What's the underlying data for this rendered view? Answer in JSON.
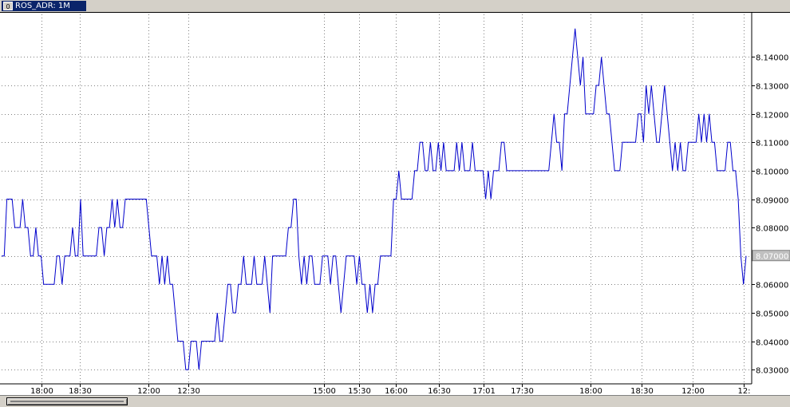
{
  "window": {
    "tab_label": "ROS_ADR: 1M",
    "tab_icon": "0"
  },
  "colors": {
    "line": "#0000cc",
    "axis": "#000000",
    "grid": "#808080",
    "price_box": "#c0c0c0"
  },
  "chart_data": {
    "type": "line",
    "title": "",
    "xlabel": "",
    "ylabel": "",
    "ylim": [
      8.025,
      8.155
    ],
    "y_ticks": [
      "8.03000",
      "8.04000",
      "8.05000",
      "8.06000",
      "8.07000",
      "8.08000",
      "8.09000",
      "8.10000",
      "8.11000",
      "8.12000",
      "8.13000",
      "8.14000"
    ],
    "y_tick_values": [
      8.03,
      8.04,
      8.05,
      8.06,
      8.07,
      8.08,
      8.09,
      8.1,
      8.11,
      8.12,
      8.13,
      8.14
    ],
    "x_tick_labels": [
      "18:00",
      "18:30",
      "12:00",
      "12:30",
      "15:00",
      "15:30",
      "16:00",
      "16:30",
      "17:01",
      "17:30",
      "18:00",
      "18:30",
      "12:00",
      "12:"
    ],
    "x_tick_index": [
      52,
      100,
      186,
      236,
      406,
      450,
      496,
      550,
      606,
      654,
      740,
      804,
      868,
      932
    ],
    "current_price": "8.07000",
    "grid": "dotted",
    "series": [
      {
        "values": [
          8.07,
          8.07,
          8.09,
          8.09,
          8.09,
          8.08,
          8.08,
          8.08,
          8.09,
          8.08,
          8.08,
          8.07,
          8.07,
          8.08,
          8.07,
          8.07,
          8.06,
          8.06,
          8.06,
          8.06,
          8.06,
          8.07,
          8.07,
          8.06,
          8.07,
          8.07,
          8.07,
          8.08,
          8.07,
          8.07,
          8.09,
          8.07,
          8.07,
          8.07,
          8.07,
          8.07,
          8.07,
          8.08,
          8.08,
          8.07,
          8.08,
          8.08,
          8.09,
          8.08,
          8.09,
          8.08,
          8.08,
          8.09,
          8.09,
          8.09,
          8.09,
          8.09,
          8.09,
          8.09,
          8.09,
          8.09,
          8.08,
          8.07,
          8.07,
          8.07,
          8.06,
          8.07,
          8.06,
          8.07,
          8.06,
          8.06,
          8.05,
          8.04,
          8.04,
          8.04,
          8.03,
          8.03,
          8.04,
          8.04,
          8.04,
          8.03,
          8.04,
          8.04,
          8.04,
          8.04,
          8.04,
          8.04,
          8.05,
          8.04,
          8.04,
          8.05,
          8.06,
          8.06,
          8.05,
          8.05,
          8.06,
          8.06,
          8.07,
          8.06,
          8.06,
          8.06,
          8.07,
          8.06,
          8.06,
          8.06,
          8.07,
          8.06,
          8.05,
          8.07,
          8.07,
          8.07,
          8.07,
          8.07,
          8.07,
          8.08,
          8.08,
          8.09,
          8.09,
          8.07,
          8.06,
          8.07,
          8.06,
          8.07,
          8.07,
          8.06,
          8.06,
          8.06,
          8.07,
          8.07,
          8.07,
          8.06,
          8.07,
          8.07,
          8.06,
          8.05,
          8.06,
          8.07,
          8.07,
          8.07,
          8.07,
          8.06,
          8.07,
          8.06,
          8.06,
          8.05,
          8.06,
          8.05,
          8.06,
          8.06,
          8.07,
          8.07,
          8.07,
          8.07,
          8.07,
          8.09,
          8.09,
          8.1,
          8.09,
          8.09,
          8.09,
          8.09,
          8.09,
          8.1,
          8.1,
          8.11,
          8.11,
          8.1,
          8.1,
          8.11,
          8.1,
          8.1,
          8.11,
          8.1,
          8.11,
          8.1,
          8.1,
          8.1,
          8.1,
          8.11,
          8.1,
          8.11,
          8.1,
          8.1,
          8.1,
          8.11,
          8.1,
          8.1,
          8.1,
          8.1,
          8.09,
          8.1,
          8.09,
          8.1,
          8.1,
          8.1,
          8.11,
          8.11,
          8.1,
          8.1,
          8.1,
          8.1,
          8.1,
          8.1,
          8.1,
          8.1,
          8.1,
          8.1,
          8.1,
          8.1,
          8.1,
          8.1,
          8.1,
          8.1,
          8.1,
          8.11,
          8.12,
          8.11,
          8.11,
          8.1,
          8.12,
          8.12,
          8.13,
          8.14,
          8.15,
          8.14,
          8.13,
          8.14,
          8.12,
          8.12,
          8.12,
          8.12,
          8.13,
          8.13,
          8.14,
          8.13,
          8.12,
          8.12,
          8.11,
          8.1,
          8.1,
          8.1,
          8.11,
          8.11,
          8.11,
          8.11,
          8.11,
          8.11,
          8.12,
          8.12,
          8.11,
          8.13,
          8.12,
          8.13,
          8.12,
          8.11,
          8.11,
          8.12,
          8.13,
          8.12,
          8.11,
          8.1,
          8.11,
          8.1,
          8.11,
          8.1,
          8.1,
          8.11,
          8.11,
          8.11,
          8.11,
          8.12,
          8.11,
          8.12,
          8.11,
          8.12,
          8.11,
          8.11,
          8.1,
          8.1,
          8.1,
          8.1,
          8.11,
          8.11,
          8.1,
          8.1,
          8.09,
          8.07,
          8.06,
          8.07
        ]
      }
    ]
  }
}
